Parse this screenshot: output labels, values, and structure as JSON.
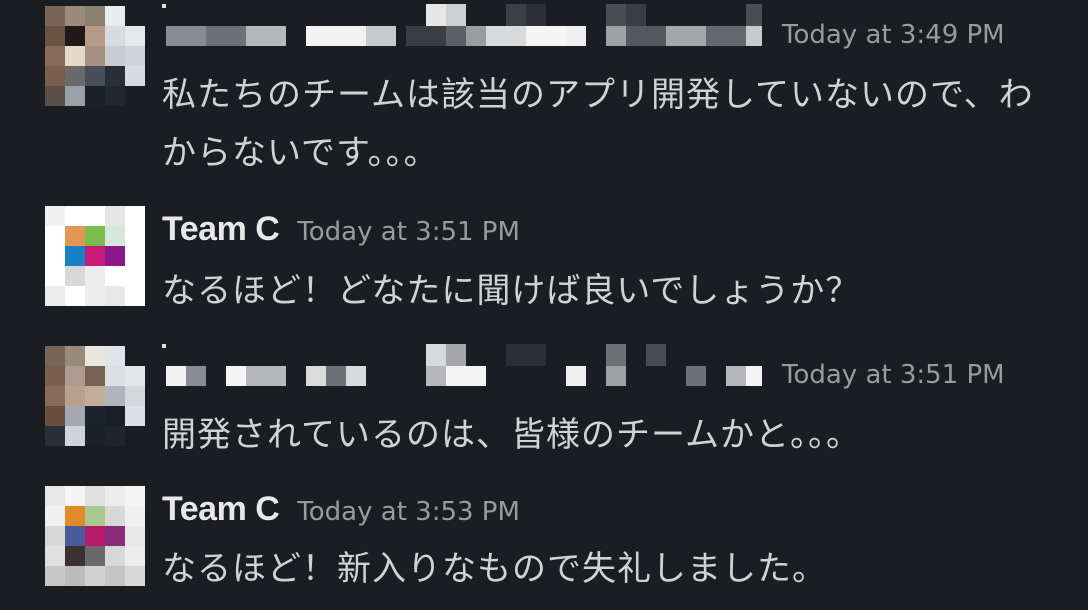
{
  "messages": [
    {
      "author": "",
      "author_redacted": true,
      "timestamp": "Today at 3:49 PM",
      "text": "私たちのチームは該当のアプリ開発していないので、わからないです。。。",
      "avatar": "blurred-photo"
    },
    {
      "author": "Team C",
      "author_redacted": false,
      "timestamp": "Today at 3:51 PM",
      "text": "なるほど！どなたに聞けば良いでしょうか？",
      "avatar": "pixel-logo"
    },
    {
      "author": "",
      "author_redacted": true,
      "timestamp": "Today at 3:51 PM",
      "text": "開発されているのは、皆様のチームかと。。。",
      "avatar": "blurred-photo"
    },
    {
      "author": "Team C",
      "author_redacted": false,
      "timestamp": "Today at 3:53 PM",
      "text": "なるほど！新入りなもので失礼しました。",
      "avatar": "pixel-logo"
    }
  ],
  "colors": {
    "background": "#1a1d21",
    "text": "#d1d2d3",
    "author": "#e8e8e8",
    "timestamp": "#9a9b9c"
  }
}
